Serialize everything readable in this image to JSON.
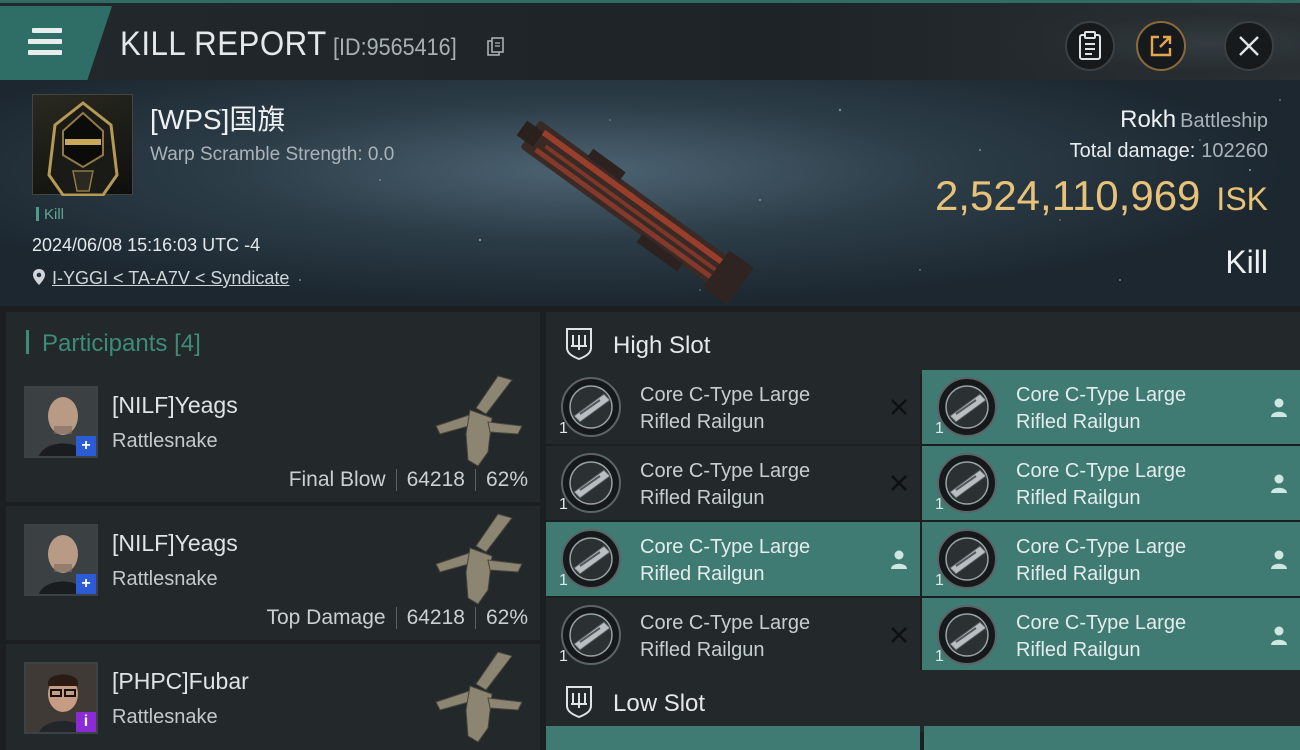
{
  "header": {
    "title": "KILL REPORT",
    "report_id": "[ID:9565416]"
  },
  "victim": {
    "name": "[WPS]国旗",
    "warp_scramble": "Warp Scramble Strength: 0.0",
    "kill_tag": "Kill",
    "datetime": "2024/06/08 15:16:03 UTC -4",
    "location": "I-YGGI < TA-A7V < Syndicate",
    "ship": "Rokh",
    "ship_class": "Battleship",
    "total_damage_label": "Total damage:",
    "total_damage": "102260",
    "isk_value": "2,524,110,969",
    "isk_unit": "ISK",
    "result": "Kill"
  },
  "participants": {
    "label": "Participants",
    "count": "[4]",
    "rows": [
      {
        "name": "[NILF]Yeags",
        "ship": "Rattlesnake",
        "role": "Final Blow",
        "damage": "64218",
        "percent": "62%",
        "badge": "+",
        "badge_color": "#2b5bd7"
      },
      {
        "name": "[NILF]Yeags",
        "ship": "Rattlesnake",
        "role": "Top Damage",
        "damage": "64218",
        "percent": "62%",
        "badge": "+",
        "badge_color": "#2b5bd7"
      },
      {
        "name": "[PHPC]Fubar",
        "ship": "Rattlesnake",
        "role": "",
        "damage": "",
        "percent": "",
        "badge": "i",
        "badge_color": "#8a2bd7"
      }
    ]
  },
  "high_slot": {
    "label": "High Slot",
    "modules": [
      {
        "line1": "Core C-Type Large",
        "line2": "Rifled Railgun",
        "qty": "1",
        "status": "destroyed",
        "state": "dark"
      },
      {
        "line1": "Core C-Type Large",
        "line2": "Rifled Railgun",
        "qty": "1",
        "status": "dropped",
        "state": "teal"
      },
      {
        "line1": "Core C-Type Large",
        "line2": "Rifled Railgun",
        "qty": "1",
        "status": "destroyed",
        "state": "dark"
      },
      {
        "line1": "Core C-Type Large",
        "line2": "Rifled Railgun",
        "qty": "1",
        "status": "dropped",
        "state": "teal"
      },
      {
        "line1": "Core C-Type Large",
        "line2": "Rifled Railgun",
        "qty": "1",
        "status": "dropped",
        "state": "teal"
      },
      {
        "line1": "Core C-Type Large",
        "line2": "Rifled Railgun",
        "qty": "1",
        "status": "dropped",
        "state": "teal"
      },
      {
        "line1": "Core C-Type Large",
        "line2": "Rifled Railgun",
        "qty": "1",
        "status": "destroyed",
        "state": "dark"
      },
      {
        "line1": "Core C-Type Large",
        "line2": "Rifled Railgun",
        "qty": "1",
        "status": "dropped",
        "state": "teal"
      }
    ]
  },
  "low_slot": {
    "label": "Low Slot"
  },
  "colors": {
    "accent_teal": "#3f7b73",
    "isk_gold": "#e9c27a",
    "participants_label": "#3d8b7a"
  },
  "icons": {
    "menu": "hamburger-menu-icon",
    "copy": "copy-icon",
    "clipboard": "clipboard-icon",
    "share": "share-icon",
    "close": "close-icon",
    "location": "location-pin-icon",
    "slot": "slot-shield-icon",
    "destroyed": "x-mark-icon",
    "dropped": "person-icon"
  }
}
